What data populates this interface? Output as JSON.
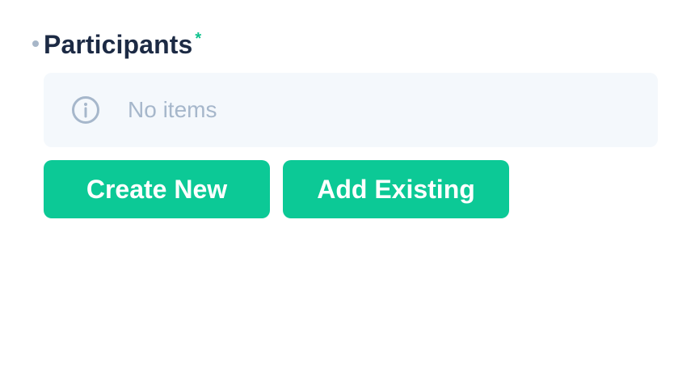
{
  "field": {
    "label": "Participants",
    "required_marker": "*",
    "empty_message": "No items",
    "info_icon": "info-circle-icon"
  },
  "actions": {
    "create_label": "Create New",
    "add_label": "Add Existing"
  },
  "colors": {
    "label": "#1c2a44",
    "required": "#10c28e",
    "bullet": "#a7b6c8",
    "empty_bg": "#f4f8fc",
    "empty_text": "#a6b7cb",
    "button_bg": "#0cc996",
    "button_text": "#ffffff"
  }
}
